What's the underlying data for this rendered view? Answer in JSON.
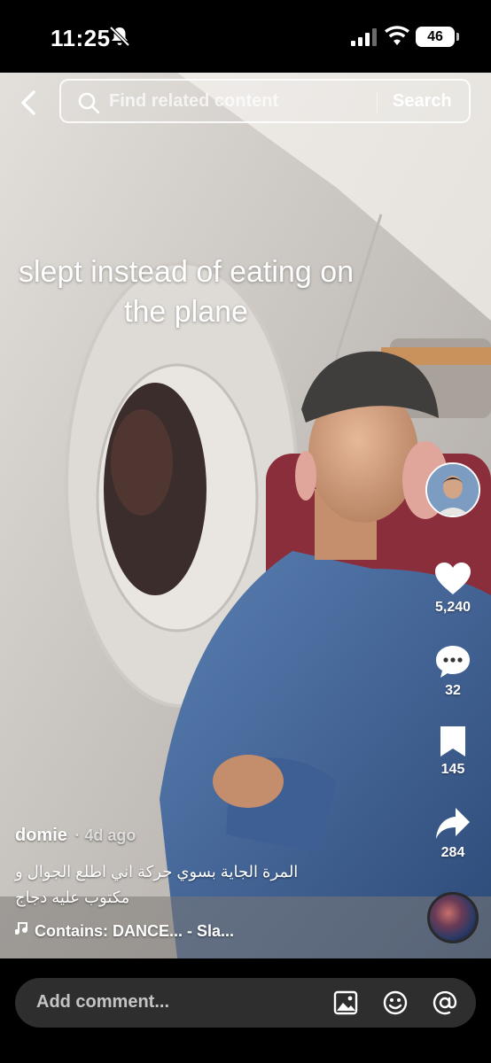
{
  "status_bar": {
    "time": "11:25",
    "battery": "46"
  },
  "search": {
    "placeholder": "Find related content",
    "button_label": "Search"
  },
  "video": {
    "overlay_text": "slept instead of eating on the plane"
  },
  "actions": {
    "likes": "5,240",
    "comments": "32",
    "saves": "145",
    "shares": "284"
  },
  "post": {
    "author": "domie",
    "time": "· 4d ago",
    "description": "المرة الجاية بسوي حركة اني اطلع الجوال و مكتوب عليه دجاج",
    "music": "Contains: DANCE... - Sla..."
  },
  "comment_bar": {
    "placeholder": "Add comment..."
  },
  "icons": {
    "back": "chevron-left-icon",
    "search": "search-icon",
    "like": "heart-icon",
    "comment": "comment-icon",
    "save": "bookmark-icon",
    "share": "share-icon",
    "music": "music-note-icon",
    "image": "image-icon",
    "emoji": "emoji-icon",
    "mention": "at-icon"
  },
  "colors": {
    "background": "#000000",
    "comment_input": "#2e2e2e",
    "text": "#ffffff"
  }
}
